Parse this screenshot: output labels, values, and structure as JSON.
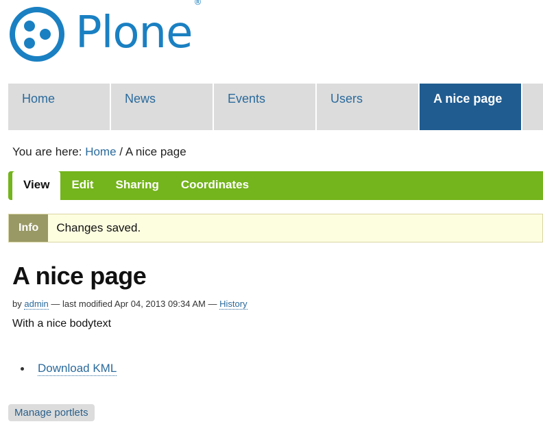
{
  "logo": {
    "text": "Plone",
    "mark": "®"
  },
  "nav": {
    "items": [
      "Home",
      "News",
      "Events",
      "Users",
      "A nice page"
    ]
  },
  "breadcrumb": {
    "prefix": "You are here:",
    "home": "Home",
    "sep": "/",
    "current": "A nice page"
  },
  "toolbar": {
    "tabs": [
      "View",
      "Edit",
      "Sharing",
      "Coordinates"
    ]
  },
  "message": {
    "label": "Info",
    "text": "Changes saved."
  },
  "page": {
    "title": "A nice page",
    "by": "by",
    "author": "admin",
    "modified": "— last modified Apr 04, 2013 09:34 AM —",
    "history": "History",
    "body": "With a nice bodytext",
    "link": "Download KML"
  },
  "portlets": {
    "label": "Manage portlets"
  },
  "colors": {
    "brand": "#1a80c2",
    "nav_active": "#205c90",
    "toolbar": "#74b41c",
    "info": "#999966"
  }
}
